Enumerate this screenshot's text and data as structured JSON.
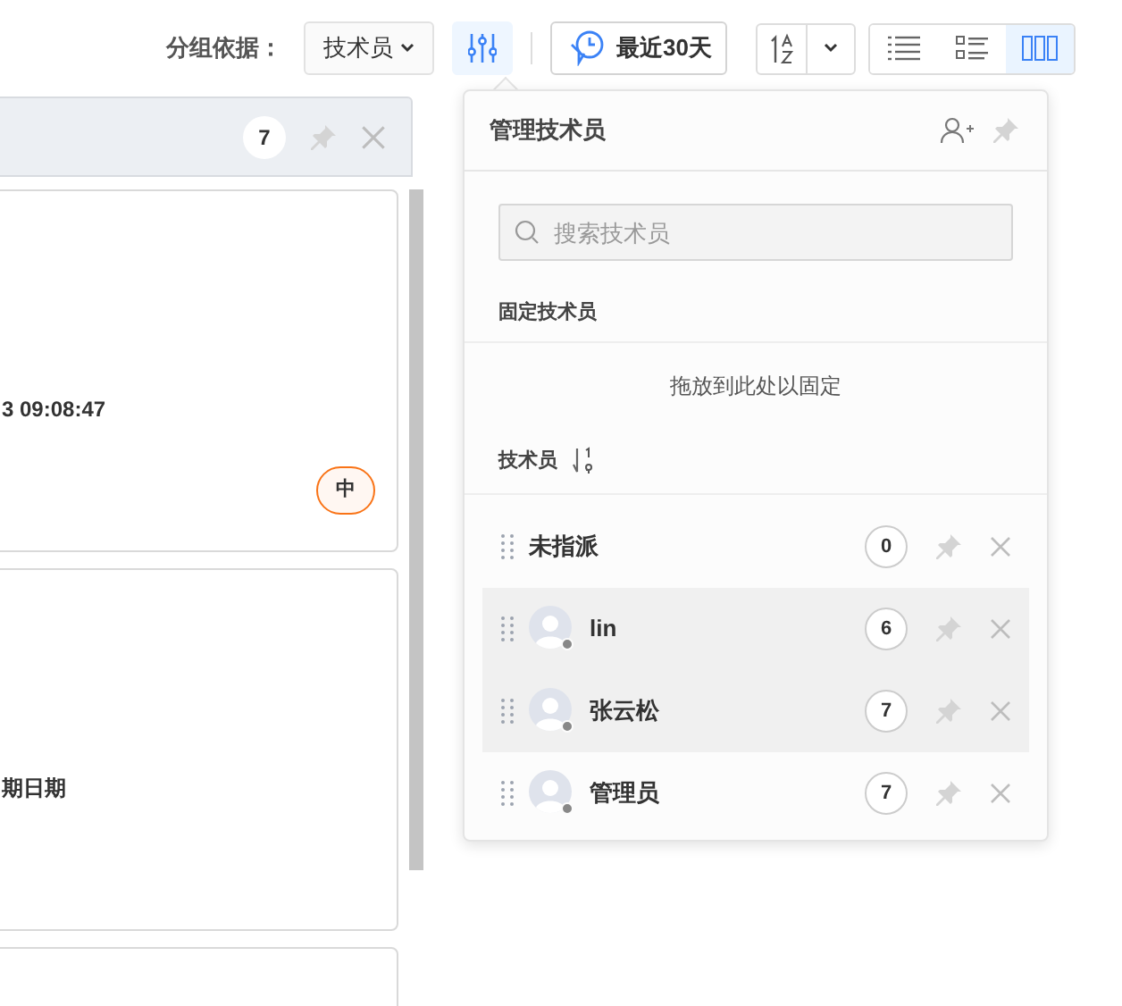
{
  "toolbar": {
    "group_label": "分组依据：",
    "group_select": "技术员",
    "filter_active": true,
    "date_button": "最近30天",
    "views": [
      {
        "kind": "list",
        "selected": false
      },
      {
        "kind": "detail",
        "selected": false
      },
      {
        "kind": "columns",
        "selected": true
      }
    ]
  },
  "column": {
    "count": "7",
    "cards": [
      {
        "kind": "ticket",
        "text": "3 09:08:47",
        "badge": "中"
      },
      {
        "kind": "ticket",
        "text": "期日期"
      },
      {
        "kind": "ticket"
      }
    ]
  },
  "popup": {
    "title": "管理技术员",
    "search_placeholder": "搜索技术员",
    "pinned_label": "固定技术员",
    "drop_hint": "拖放到此处以固定",
    "list_label": "技术员",
    "rows": [
      {
        "kind": "unassigned",
        "name": "未指派",
        "count": "0",
        "highlighted": false
      },
      {
        "kind": "user",
        "name": "lin",
        "count": "6",
        "highlighted": true
      },
      {
        "kind": "user",
        "name": "张云松",
        "count": "7",
        "highlighted": true
      },
      {
        "kind": "user",
        "name": "管理员",
        "count": "7",
        "highlighted": false
      }
    ]
  }
}
